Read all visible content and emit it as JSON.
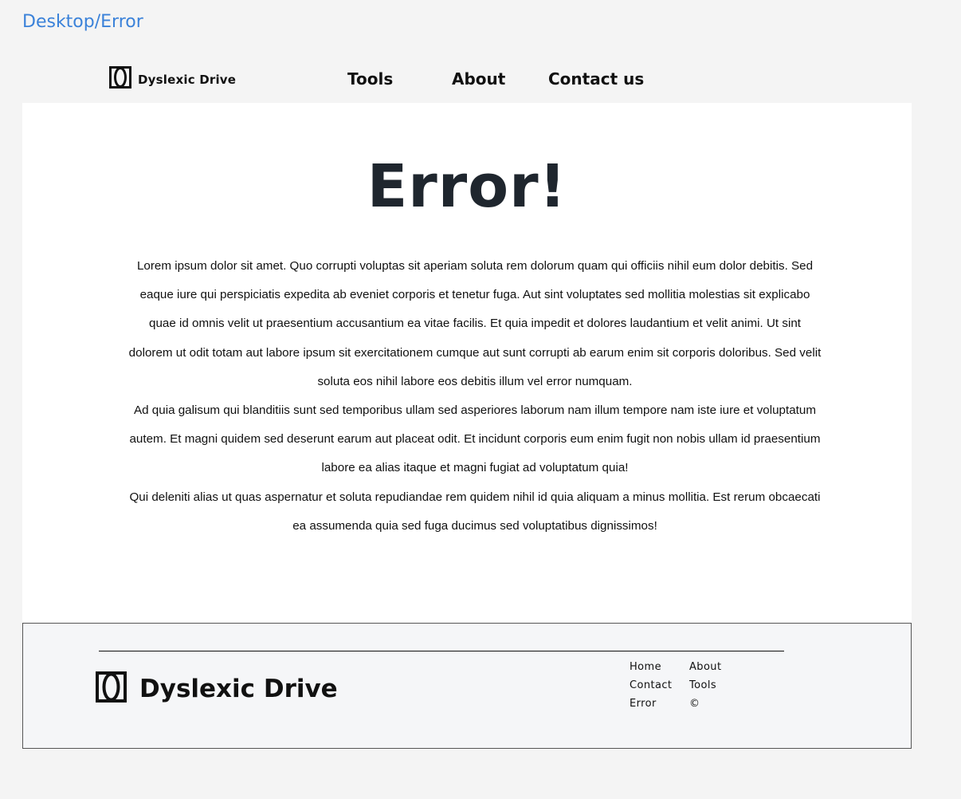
{
  "frame_label": "Desktop/Error",
  "brand": {
    "name": "Dyslexic Drive",
    "logo_icon": "dyslexic-drive-logo-icon"
  },
  "nav": {
    "tools": "Tools",
    "about": "About",
    "contact": "Contact us"
  },
  "main": {
    "title": "Error!",
    "paragraphs": [
      "Lorem ipsum dolor sit amet. Quo corrupti voluptas sit aperiam soluta rem dolorum quam qui officiis nihil eum dolor debitis. Sed eaque iure qui perspiciatis expedita ab eveniet corporis et tenetur fuga. Aut sint voluptates sed mollitia molestias sit explicabo quae id omnis velit ut praesentium accusantium ea vitae facilis. Et quia impedit et dolores laudantium et velit animi. Ut sint dolorem ut odit totam aut labore ipsum sit exercitationem cumque aut sunt corrupti ab earum enim sit corporis doloribus. Sed velit soluta eos nihil labore eos debitis illum vel error numquam.",
      "Ad quia galisum qui blanditiis sunt sed temporibus ullam sed asperiores laborum nam illum tempore nam iste iure et voluptatum autem. Et magni quidem sed deserunt earum aut placeat odit. Et incidunt corporis eum enim fugit non nobis ullam id praesentium labore ea alias itaque et magni fugiat ad voluptatum quia!",
      "Qui deleniti alias ut quas aspernatur et soluta repudiandae rem quidem nihil id quia aliquam a minus mollitia. Est rerum obcaecati ea assumenda quia sed fuga ducimus sed voluptatibus dignissimos!"
    ]
  },
  "footer": {
    "brand": "Dyslexic Drive",
    "links": {
      "home": "Home",
      "about": "About",
      "contact": "Contact",
      "tools": "Tools",
      "error": "Error",
      "copyright": "©"
    }
  },
  "colors": {
    "frame_label": "#3b82d9",
    "page_bg": "#f4f4f4",
    "content_bg": "#ffffff",
    "title_text": "#1f262e",
    "footer_bg": "#f5f6f8"
  }
}
